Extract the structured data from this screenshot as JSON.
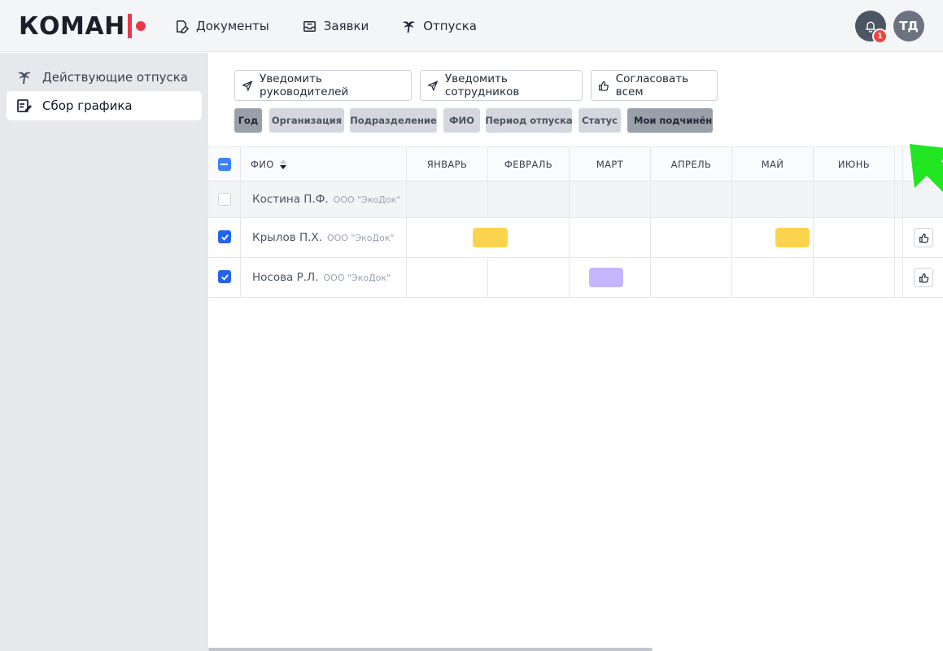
{
  "header": {
    "logo": "КОМАН",
    "nav": [
      {
        "label": "Документы",
        "icon": "document-edit-icon"
      },
      {
        "label": "Заявки",
        "icon": "inbox-icon"
      },
      {
        "label": "Отпуска",
        "icon": "palm-tree-icon"
      }
    ],
    "notifications_count": "1",
    "user_initials": "ТД"
  },
  "sidebar": {
    "items": [
      {
        "label": "Действующие отпуска",
        "icon": "palm-tree-icon",
        "active": false
      },
      {
        "label": "Сбор графика",
        "icon": "schedule-edit-icon",
        "active": true
      }
    ]
  },
  "toolbar": {
    "notify_managers": "Уведомить руководителей",
    "notify_employees": "Уведомить сотрудников",
    "approve_all": "Согласовать всем"
  },
  "filters": [
    "Год",
    "Организация",
    "Подразделение",
    "ФИО",
    "Период отпуска",
    "Статус",
    "Мои подчинённые"
  ],
  "table": {
    "columns": [
      "ФИО",
      "ЯНВАРЬ",
      "ФЕВРАЛЬ",
      "МАРТ",
      "АПРЕЛЬ",
      "МАЙ",
      "ИЮНЬ"
    ],
    "rows": [
      {
        "name": "Костина П.Ф.",
        "org": "ООО \"ЭкоДок\"",
        "checked": false
      },
      {
        "name": "Крылов П.Х.",
        "org": "ООО \"ЭкоДок\"",
        "checked": true
      },
      {
        "name": "Носова Р.Л.",
        "org": "ООО \"ЭкоДок\"",
        "checked": true
      }
    ]
  },
  "colors": {
    "accent": "#2563eb",
    "logo_red": "#e8394a",
    "vacation_yellow": "#fcd34d",
    "vacation_purple": "#c4b5fd",
    "pointer_green": "#22e622"
  }
}
